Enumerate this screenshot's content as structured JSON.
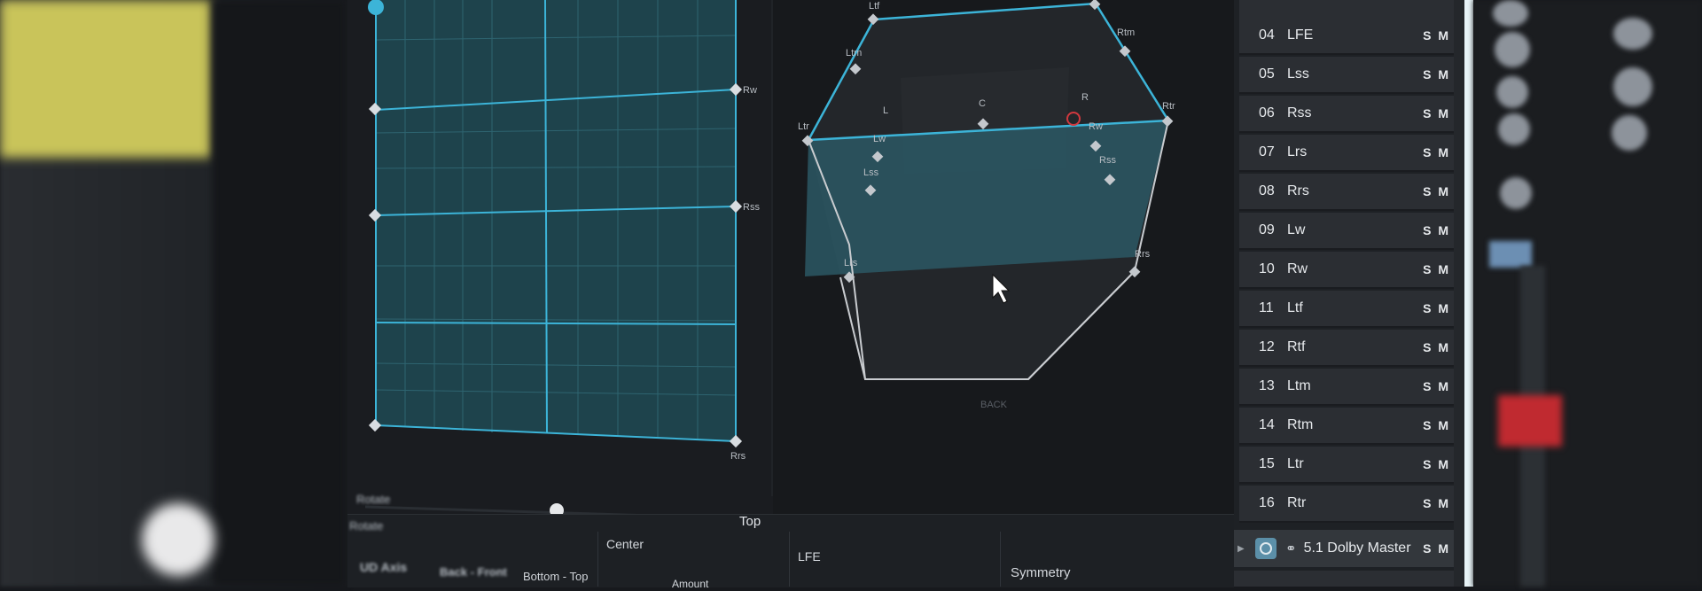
{
  "front_view": {
    "labels": {
      "rw": "Rw",
      "rss": "Rss",
      "rrs": "Rrs"
    },
    "bottom_slider_label": "Top"
  },
  "cube_view": {
    "speakers": {
      "ltf": "Ltf",
      "rtm": "Rtm",
      "ltm": "Ltm",
      "rtr": "Rtr",
      "ltr": "Ltr",
      "l": "L",
      "c": "C",
      "r": "R",
      "lw": "Lw",
      "rw": "Rw",
      "lss": "Lss",
      "rss": "Rss",
      "lrs": "Lrs",
      "rrs": "Rrs"
    },
    "back_label": "BACK",
    "accent": "#3bb3d6"
  },
  "bottom": {
    "left_blur_1": "Rotate",
    "left_blur_2": "Rotate",
    "ud_axis": "UD Axis",
    "back_front": "Back - Front",
    "bottom_top": "Bottom - Top",
    "center": "Center",
    "amount": "Amount",
    "lfe": "LFE",
    "symmetry": "Symmetry"
  },
  "channels": [
    {
      "num": "04",
      "name": "LFE",
      "sm": "S M"
    },
    {
      "num": "05",
      "name": "Lss",
      "sm": "S M"
    },
    {
      "num": "06",
      "name": "Rss",
      "sm": "S M"
    },
    {
      "num": "07",
      "name": "Lrs",
      "sm": "S M"
    },
    {
      "num": "08",
      "name": "Rrs",
      "sm": "S M"
    },
    {
      "num": "09",
      "name": "Lw",
      "sm": "S M"
    },
    {
      "num": "10",
      "name": "Rw",
      "sm": "S M"
    },
    {
      "num": "11",
      "name": "Ltf",
      "sm": "S M"
    },
    {
      "num": "12",
      "name": "Rtf",
      "sm": "S M"
    },
    {
      "num": "13",
      "name": "Ltm",
      "sm": "S M"
    },
    {
      "num": "14",
      "name": "Rtm",
      "sm": "S M"
    },
    {
      "num": "15",
      "name": "Ltr",
      "sm": "S M"
    },
    {
      "num": "16",
      "name": "Rtr",
      "sm": "S M"
    }
  ],
  "master_bus": {
    "name": "5.1 Dolby Master",
    "sm": "S M"
  }
}
